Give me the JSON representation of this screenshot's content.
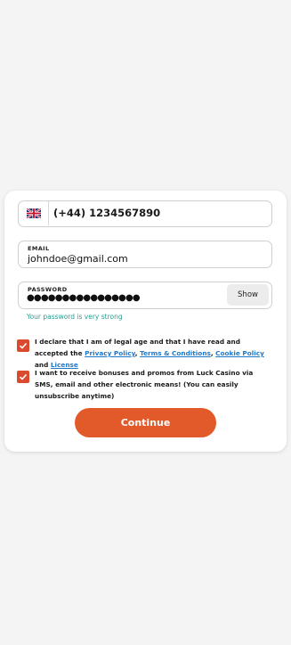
{
  "colors": {
    "accent": "#e35a2a",
    "checkbox": "#d94a2e",
    "link": "#1f78c9",
    "strength_ok": "#2a9d8f"
  },
  "phone": {
    "flag_icon": "uk-flag-icon",
    "value": "(+44)  1234567890"
  },
  "email": {
    "label": "EMAIL",
    "value": "johndoe@gmail.com"
  },
  "password": {
    "label": "PASSWORD",
    "value": "●●●●●●●●●●●●●●●●",
    "show_label": "Show"
  },
  "password_strength": "Your password is very strong",
  "consent_terms": {
    "checked": true,
    "text_before": "I declare that I am of legal age and that I have read and accepted the ",
    "privacy_link": "Privacy Policy",
    "sep1": ", ",
    "terms_link": "Terms & Conditions",
    "sep2": ", ",
    "cookie_link": "Cookie Policy",
    "sep3": " and ",
    "license_link": "License"
  },
  "consent_promos": {
    "checked": true,
    "text": "I want to receive bonuses and promos from Luck Casino via SMS, email and other electronic means! (You can easily unsubscribe anytime)"
  },
  "continue_label": "Continue"
}
